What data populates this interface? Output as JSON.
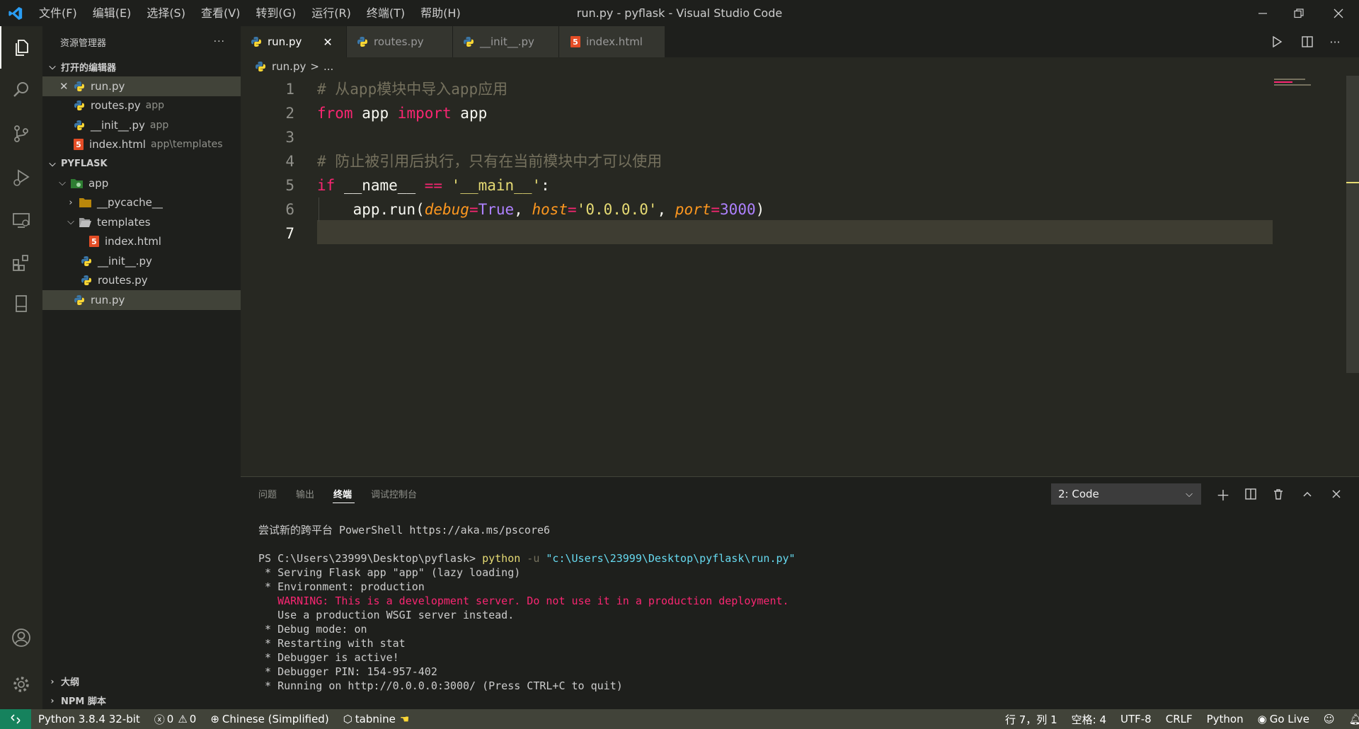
{
  "window": {
    "title": "run.py - pyflask - Visual Studio Code",
    "menu": [
      "文件(F)",
      "编辑(E)",
      "选择(S)",
      "查看(V)",
      "转到(G)",
      "运行(R)",
      "终端(T)",
      "帮助(H)"
    ]
  },
  "sidebar": {
    "title": "资源管理器",
    "more": "···",
    "open_editors": {
      "header": "打开的编辑器",
      "items": [
        {
          "name": "run.py",
          "detail": ""
        },
        {
          "name": "routes.py",
          "detail": "app"
        },
        {
          "name": "__init__.py",
          "detail": "app"
        },
        {
          "name": "index.html",
          "detail": "app\\templates"
        }
      ]
    },
    "project": {
      "header": "PYFLASK",
      "tree": [
        {
          "name": "app"
        },
        {
          "name": "__pycache__"
        },
        {
          "name": "templates"
        },
        {
          "name": "index.html"
        },
        {
          "name": "__init__.py"
        },
        {
          "name": "routes.py"
        },
        {
          "name": "run.py"
        }
      ]
    },
    "outline": "大纲",
    "npm": "NPM 脚本"
  },
  "tabs": [
    {
      "label": "run.py",
      "active": true
    },
    {
      "label": "routes.py",
      "active": false
    },
    {
      "label": "__init__.py",
      "active": false
    },
    {
      "label": "index.html",
      "active": false
    }
  ],
  "breadcrumb": {
    "file": "run.py",
    "sep": ">",
    "rest": "..."
  },
  "editor": {
    "line_numbers": [
      "1",
      "2",
      "3",
      "4",
      "5",
      "6",
      "7"
    ],
    "code": {
      "l1": "# 从app模块中导入app应用",
      "l2_from": "from",
      "l2_mod": " app ",
      "l2_import": "import",
      "l2_name": " app",
      "l4": "# 防止被引用后执行，只有在当前模块中才可以使用",
      "l5_if": "if",
      "l5_a": " __name__ ",
      "l5_eq": "==",
      "l5_s": " '__main__'",
      "l5_c": ":",
      "l6_a": "    app.run(",
      "l6_p1": "debug",
      "l6_eq1": "=",
      "l6_v1": "True",
      "l6_sep1": ", ",
      "l6_p2": "host",
      "l6_eq2": "=",
      "l6_v2": "'0.0.0.0'",
      "l6_sep2": ", ",
      "l6_p3": "port",
      "l6_eq3": "=",
      "l6_v3": "3000",
      "l6_end": ")"
    }
  },
  "panel": {
    "tabs": [
      "问题",
      "输出",
      "终端",
      "调试控制台"
    ],
    "active_tab": "终端",
    "terminal_select": "2: Code",
    "terminal": {
      "l1": "尝试新的跨平台 PowerShell https://aka.ms/pscore6",
      "l2_prompt": "PS C:\\Users\\23999\\Desktop\\pyflask> ",
      "l2_cmd": "python",
      "l2_flag": " -u ",
      "l2_path": "\"c:\\Users\\23999\\Desktop\\pyflask\\run.py\"",
      "l3": " * Serving Flask app \"app\" (lazy loading)",
      "l4": " * Environment: production",
      "l5": "   WARNING: This is a development server. Do not use it in a production deployment.",
      "l6": "   Use a production WSGI server instead.",
      "l7": " * Debug mode: on",
      "l8": " * Restarting with stat",
      "l9": " * Debugger is active!",
      "l10": " * Debugger PIN: 154-957-402",
      "l11": " * Running on http://0.0.0.0:3000/ (Press CTRL+C to quit)"
    }
  },
  "statusbar": {
    "interpreter": "Python 3.8.4 32-bit",
    "errors": "0",
    "warnings": "0",
    "language_pack": "Chinese (Simplified)",
    "tabnine": "tabnine",
    "position": "行 7，列 1",
    "indent": "空格: 4",
    "encoding": "UTF-8",
    "eol": "CRLF",
    "language": "Python",
    "golive": "Go Live"
  },
  "colors": {
    "editor_bg": "#272822",
    "sidebar_bg": "#1e1f1c",
    "status_bg": "#414339",
    "remote_bg": "#16825d",
    "keyword": "#f92672",
    "string": "#e6db74",
    "number": "#ae81ff",
    "param": "#fd971f",
    "comment": "#75715e"
  }
}
